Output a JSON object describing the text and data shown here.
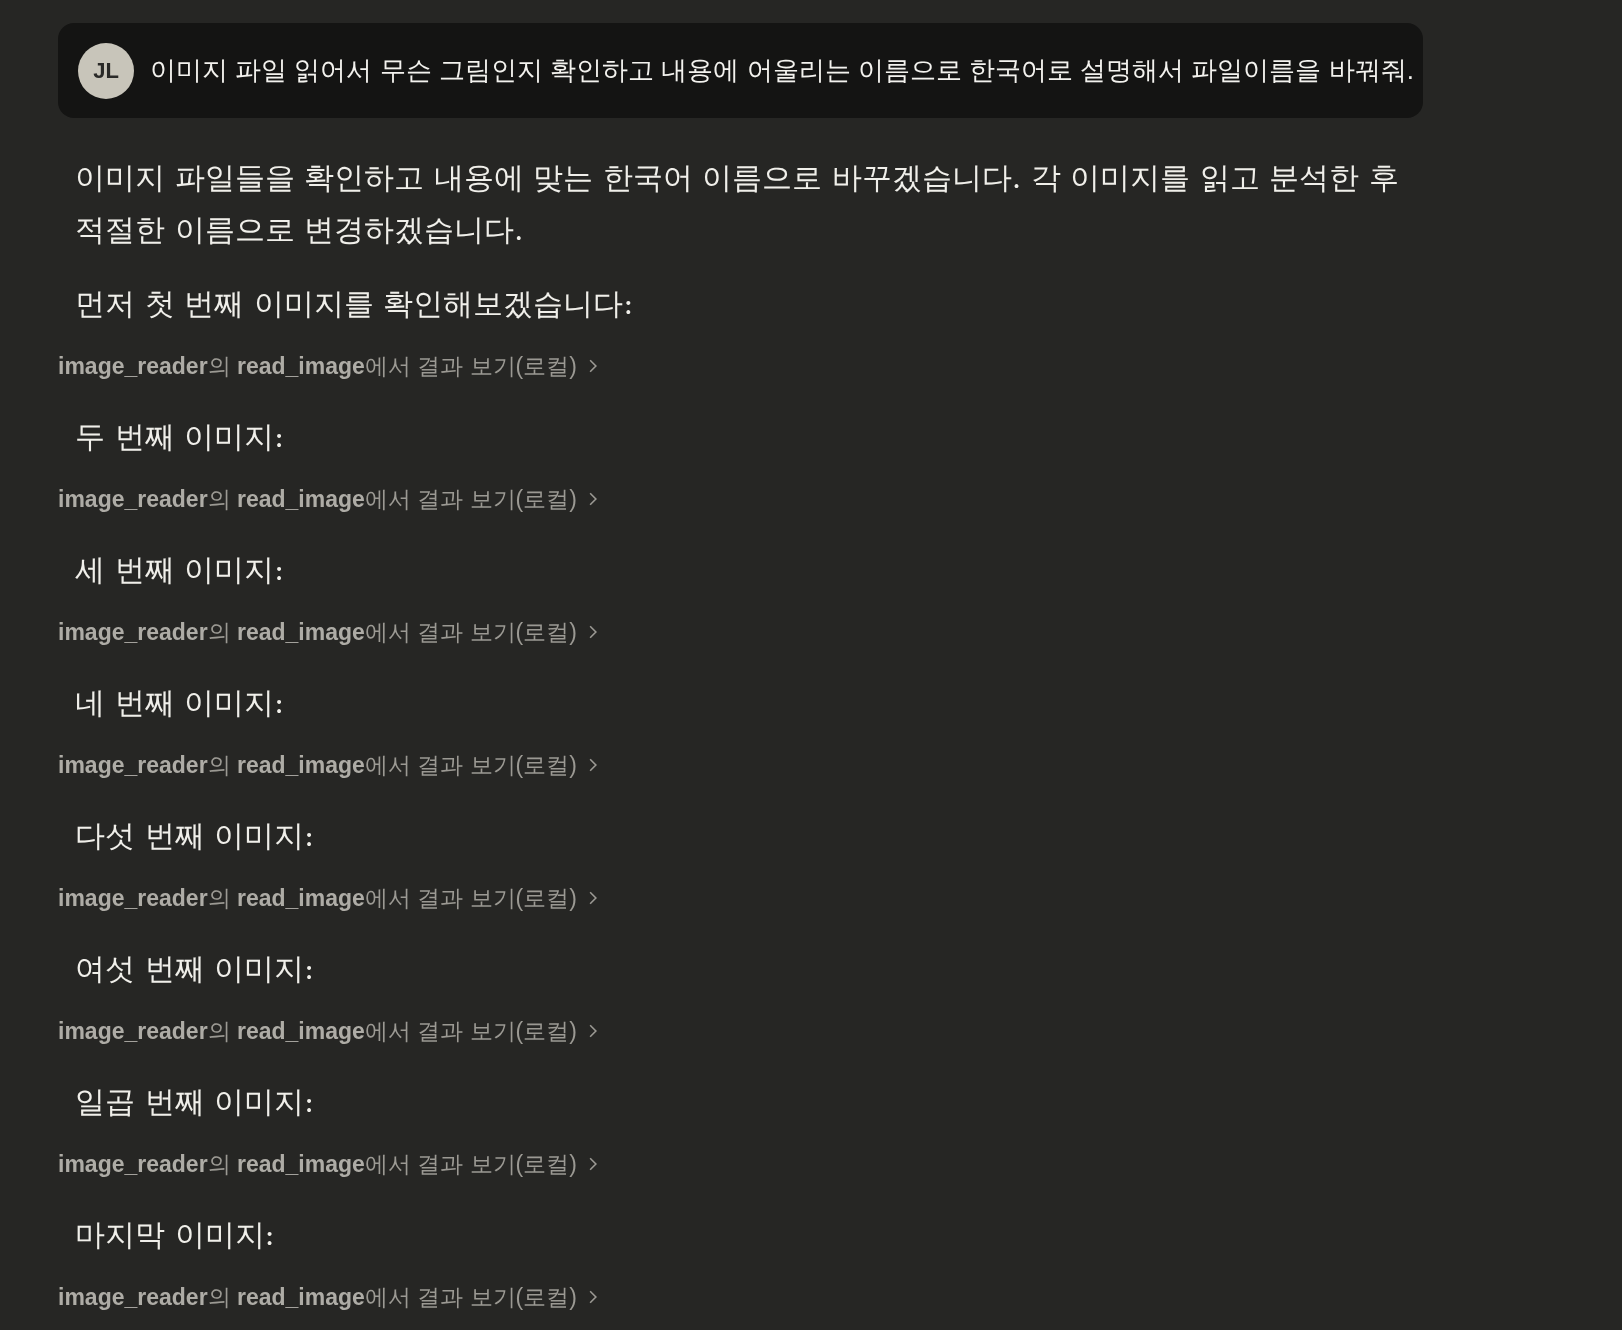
{
  "user_message": {
    "avatar": "JL",
    "text": "이미지 파일 읽어서 무슨 그림인지 확인하고 내용에 어울리는 이름으로 한국어로 설명해서 파일이름을 바꿔줘."
  },
  "response": [
    {
      "kind": "paragraph",
      "text": "이미지 파일들을 확인하고 내용에 맞는 한국어 이름으로 바꾸겠습니다. 각 이미지를 읽고 분석한 후 적절한 이름으로 변경하겠습니다."
    },
    {
      "kind": "paragraph",
      "text": "먼저 첫 번째 이미지를 확인해보겠습니다:"
    },
    {
      "kind": "tool",
      "text": "**image_reader**의 **read_image**에서 결과 보기(로컬)"
    },
    {
      "kind": "paragraph",
      "text": "두 번째 이미지:"
    },
    {
      "kind": "tool",
      "text": "**image_reader**의 **read_image**에서 결과 보기(로컬)"
    },
    {
      "kind": "paragraph",
      "text": "세 번째 이미지:"
    },
    {
      "kind": "tool",
      "text": "**image_reader**의 **read_image**에서 결과 보기(로컬)"
    },
    {
      "kind": "paragraph",
      "text": "네 번째 이미지:"
    },
    {
      "kind": "tool",
      "text": "**image_reader**의 **read_image**에서 결과 보기(로컬)"
    },
    {
      "kind": "paragraph",
      "text": "다섯 번째 이미지:"
    },
    {
      "kind": "tool",
      "text": "**image_reader**의 **read_image**에서 결과 보기(로컬)"
    },
    {
      "kind": "paragraph",
      "text": "여섯 번째 이미지:"
    },
    {
      "kind": "tool",
      "text": "**image_reader**의 **read_image**에서 결과 보기(로컬)"
    },
    {
      "kind": "paragraph",
      "text": "일곱 번째 이미지:"
    },
    {
      "kind": "tool",
      "text": "**image_reader**의 **read_image**에서 결과 보기(로컬)"
    },
    {
      "kind": "paragraph",
      "text": "마지막 이미지:"
    },
    {
      "kind": "tool",
      "text": "**image_reader**의 **read_image**에서 결과 보기(로컬)"
    }
  ]
}
